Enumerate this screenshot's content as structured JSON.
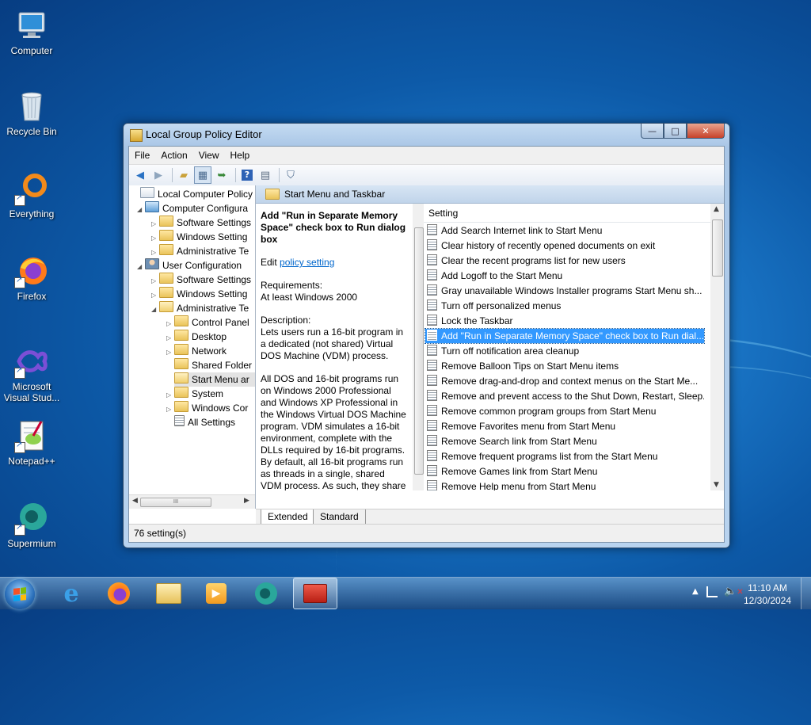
{
  "desktop": {
    "icons": [
      {
        "label": "Computer",
        "icon": "computer-icon"
      },
      {
        "label": "Recycle Bin",
        "icon": "recycle-bin-icon"
      },
      {
        "label": "Everything",
        "icon": "everything-icon"
      },
      {
        "label": "Firefox",
        "icon": "firefox-icon"
      },
      {
        "label": "Microsoft Visual Stud...",
        "icon": "visual-studio-icon"
      },
      {
        "label": "Notepad++",
        "icon": "notepad-plus-plus-icon"
      },
      {
        "label": "Supermium",
        "icon": "supermium-icon"
      }
    ]
  },
  "window": {
    "title": "Local Group Policy Editor",
    "buttons": {
      "minimize": "—",
      "maximize": "□",
      "close": "✕"
    },
    "menu": [
      "File",
      "Action",
      "View",
      "Help"
    ],
    "toolbar": [
      "back-arrow-icon",
      "forward-arrow-icon",
      "up-folder-icon",
      "show-hide-tree-icon",
      "export-list-icon",
      "help-icon",
      "properties-icon",
      "filter-icon"
    ]
  },
  "tree": {
    "nodes": [
      {
        "label": "Local Computer Policy",
        "expander": ""
      },
      {
        "label": "Computer Configura",
        "expander": "◢"
      },
      {
        "label": "Software Settings",
        "expander": "▷"
      },
      {
        "label": "Windows Setting",
        "expander": "▷"
      },
      {
        "label": "Administrative Te",
        "expander": "▷"
      },
      {
        "label": "User Configuration",
        "expander": "◢"
      },
      {
        "label": "Software Settings",
        "expander": "▷"
      },
      {
        "label": "Windows Setting",
        "expander": "▷"
      },
      {
        "label": "Administrative Te",
        "expander": "◢"
      },
      {
        "label": "Control Panel",
        "expander": "▷"
      },
      {
        "label": "Desktop",
        "expander": "▷"
      },
      {
        "label": "Network",
        "expander": "▷"
      },
      {
        "label": "Shared Folder",
        "expander": ""
      },
      {
        "label": "Start Menu ar",
        "expander": ""
      },
      {
        "label": "System",
        "expander": "▷"
      },
      {
        "label": "Windows Cor",
        "expander": "▷"
      },
      {
        "label": "All Settings",
        "expander": ""
      }
    ],
    "scroll_thumb": "III"
  },
  "details": {
    "header": "Start Menu and Taskbar",
    "title": "Add \"Run in Separate Memory Space\" check box to Run dialog box",
    "edit_prefix": "Edit",
    "edit_link": "policy setting",
    "requirements_label": "Requirements:",
    "requirements_value": "At least Windows 2000",
    "description_label": "Description:",
    "description_p1": "Lets users run a 16-bit program in a dedicated (not shared) Virtual DOS Machine (VDM) process.",
    "description_p2": "All DOS and 16-bit programs run on Windows 2000 Professional and Windows XP Professional in the Windows Virtual DOS Machine program. VDM simulates a 16-bit environment, complete with the DLLs required by 16-bit programs. By default, all 16-bit programs run as threads in a single, shared VDM process. As such, they share the memory space allocated to the VDM process and cannot run"
  },
  "settings": {
    "column_header": "Setting",
    "selected_index": 7,
    "items": [
      "Add Search Internet link to Start Menu",
      "Clear history of recently opened documents on exit",
      "Clear the recent programs list for new users",
      "Add Logoff to the Start Menu",
      "Gray unavailable Windows Installer programs Start Menu sh...",
      "Turn off personalized menus",
      "Lock the Taskbar",
      "Add \"Run in Separate Memory Space\" check box to Run dial...",
      "Turn off notification area cleanup",
      "Remove Balloon Tips on Start Menu items",
      "Remove drag-and-drop and context menus on the Start Me...",
      "Remove and prevent access to the Shut Down, Restart, Sleep...",
      "Remove common program groups from Start Menu",
      "Remove Favorites menu from Start Menu",
      "Remove Search link from Start Menu",
      "Remove frequent programs list from the Start Menu",
      "Remove Games link from Start Menu",
      "Remove Help menu from Start Menu"
    ]
  },
  "tabs": [
    "Extended",
    "Standard"
  ],
  "status": "76 setting(s)",
  "taskbar": {
    "apps": [
      "internet-explorer-icon",
      "firefox-icon",
      "file-explorer-icon",
      "media-player-icon",
      "supermium-icon",
      "group-policy-editor-icon"
    ],
    "active_app": 5,
    "time": "11:10 AM",
    "date": "12/30/2024",
    "tray": [
      "show-hidden-icons-icon",
      "network-icon",
      "volume-muted-icon"
    ]
  }
}
